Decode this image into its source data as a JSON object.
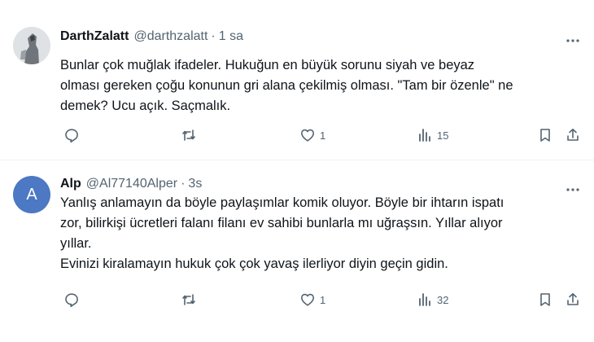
{
  "posts": [
    {
      "author": "DarthZalatt",
      "handle": "@darthzalatt",
      "dot": "·",
      "time": "1 sa",
      "text": "Bunlar çok muğlak ifadeler. Hukuğun en büyük sorunu siyah ve beyaz\nolması gereken çoğu konunun gri alana çekilmiş olması. \"Tam bir özenle\" ne\ndemek? Ucu açık. Saçmalık.",
      "replies": "",
      "reposts": "",
      "likes": "1",
      "views": "15",
      "avatar_letter": ""
    },
    {
      "author": "Alp",
      "handle": "@Al77140Alper",
      "dot": "·",
      "time": "3s",
      "text": "Yanlış anlamayın da böyle paylaşımlar komik oluyor. Böyle bir ihtarın ispatı\nzor, bilirkişi ücretleri falanı filanı ev sahibi bunlarla mı uğraşsın. Yıllar alıyor\nyıllar.\nEvinizi kiralamayın hukuk çok çok yavaş ilerliyor diyin geçin gidin.",
      "replies": "",
      "reposts": "",
      "likes": "1",
      "views": "32",
      "avatar_letter": "A"
    }
  ],
  "colors": {
    "muted": "#536471",
    "text": "#0f1419",
    "avatar_alp": "#4c78c4"
  },
  "icons": [
    "more-icon",
    "reply-icon",
    "repost-icon",
    "like-icon",
    "views-icon",
    "bookmark-icon",
    "share-icon"
  ]
}
